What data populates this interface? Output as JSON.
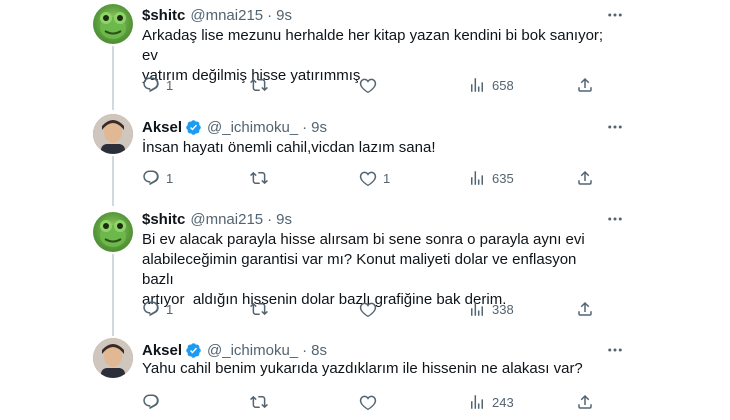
{
  "tweets": [
    {
      "display_name": "$shitc",
      "handle": "@mnai215",
      "time": "9s",
      "text": "Arkadaş lise mezunu herhalde her kitap yazan kendini bi bok sanıyor; ev\nyatırım değilmiş hisse yatırımmış",
      "replies": "1",
      "retweets": "",
      "likes": "",
      "views": "658",
      "verified": false,
      "avatar": "frog-avatar"
    },
    {
      "display_name": "Aksel",
      "handle": "@_ichimoku_",
      "time": "9s",
      "text": "İnsan hayatı önemli cahil,vicdan lazım sana!",
      "replies": "1",
      "retweets": "",
      "likes": "1",
      "views": "635",
      "verified": true,
      "avatar": "person-avatar"
    },
    {
      "display_name": "$shitc",
      "handle": "@mnai215",
      "time": "9s",
      "text": "Bi ev alacak parayla hisse alırsam bi sene sonra o parayla aynı evi\nalabileceğimin garantisi var mı? Konut maliyeti dolar ve enflasyon bazlı\nartıyor  aldığın hissenin dolar bazlı grafiğine bak derim.",
      "replies": "1",
      "retweets": "",
      "likes": "",
      "views": "338",
      "verified": false,
      "avatar": "frog-avatar"
    },
    {
      "display_name": "Aksel",
      "handle": "@_ichimoku_",
      "time": "8s",
      "text": "Yahu cahil benim yukarıda yazdıklarım ile hissenin ne alakası var?",
      "replies": "",
      "retweets": "",
      "likes": "",
      "views": "243",
      "verified": true,
      "avatar": "person-avatar"
    }
  ],
  "colors": {
    "text": "#0f1419",
    "muted": "#536471",
    "verified": "#1d9bf0",
    "thread_line": "#cfd9de"
  },
  "icons": {
    "reply": "reply-icon",
    "retweet": "retweet-icon",
    "like": "like-icon",
    "views": "views-icon",
    "share": "share-icon",
    "more": "more-icon",
    "verified": "verified-badge-icon"
  }
}
